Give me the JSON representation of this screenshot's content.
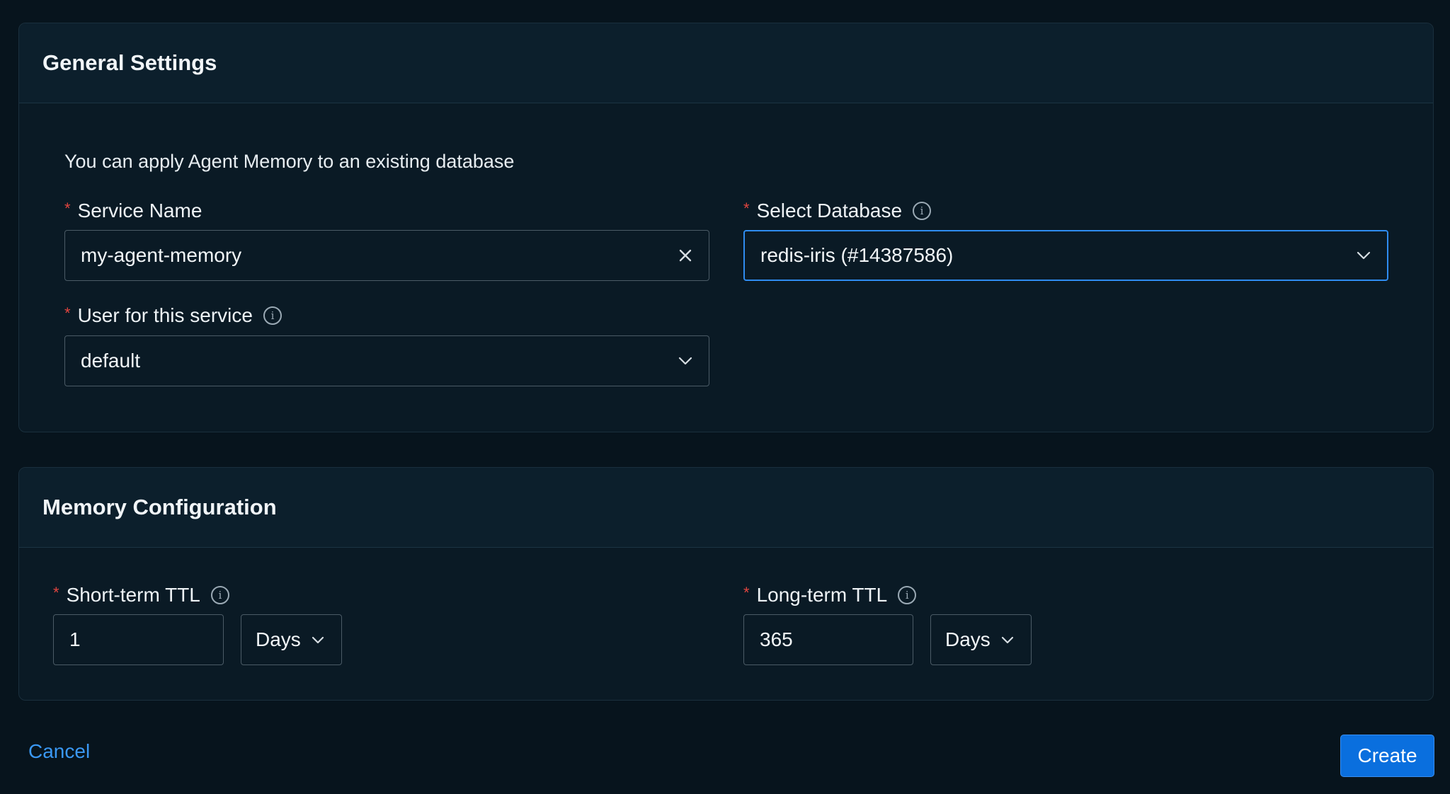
{
  "general": {
    "title": "General Settings",
    "intro": "You can apply Agent Memory to an existing database",
    "service_name": {
      "label": "Service Name",
      "value": "my-agent-memory"
    },
    "select_database": {
      "label": "Select Database",
      "value": "redis-iris (#14387586)"
    },
    "user": {
      "label": "User for this service",
      "value": "default"
    }
  },
  "memory": {
    "title": "Memory Configuration",
    "short_term": {
      "label": "Short-term TTL",
      "value": "1",
      "unit": "Days"
    },
    "long_term": {
      "label": "Long-term TTL",
      "value": "365",
      "unit": "Days"
    }
  },
  "footer": {
    "cancel": "Cancel",
    "create": "Create"
  },
  "required_marker": "*",
  "info_glyph": "i",
  "colors": {
    "accent": "#0a6fde",
    "link": "#3a98f3",
    "required": "#e2453f",
    "background": "#07141d"
  }
}
